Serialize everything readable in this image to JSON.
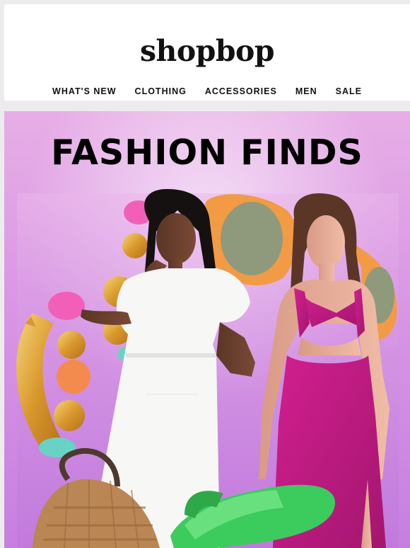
{
  "brand": {
    "logo_text": "shopbop"
  },
  "nav": {
    "items": [
      "WHAT'S NEW",
      "CLOTHING",
      "ACCESSORIES",
      "MEN",
      "SALE"
    ]
  },
  "hero": {
    "title": "FASHION FINDS",
    "background_colors": [
      "#e7aee6",
      "#c67fe0"
    ],
    "products": [
      "white-dress-model",
      "pink-cutout-dress-model",
      "gold-hoop-earrings",
      "orange-sunglasses",
      "woven-hobo-bag",
      "green-platform-sandal"
    ]
  }
}
